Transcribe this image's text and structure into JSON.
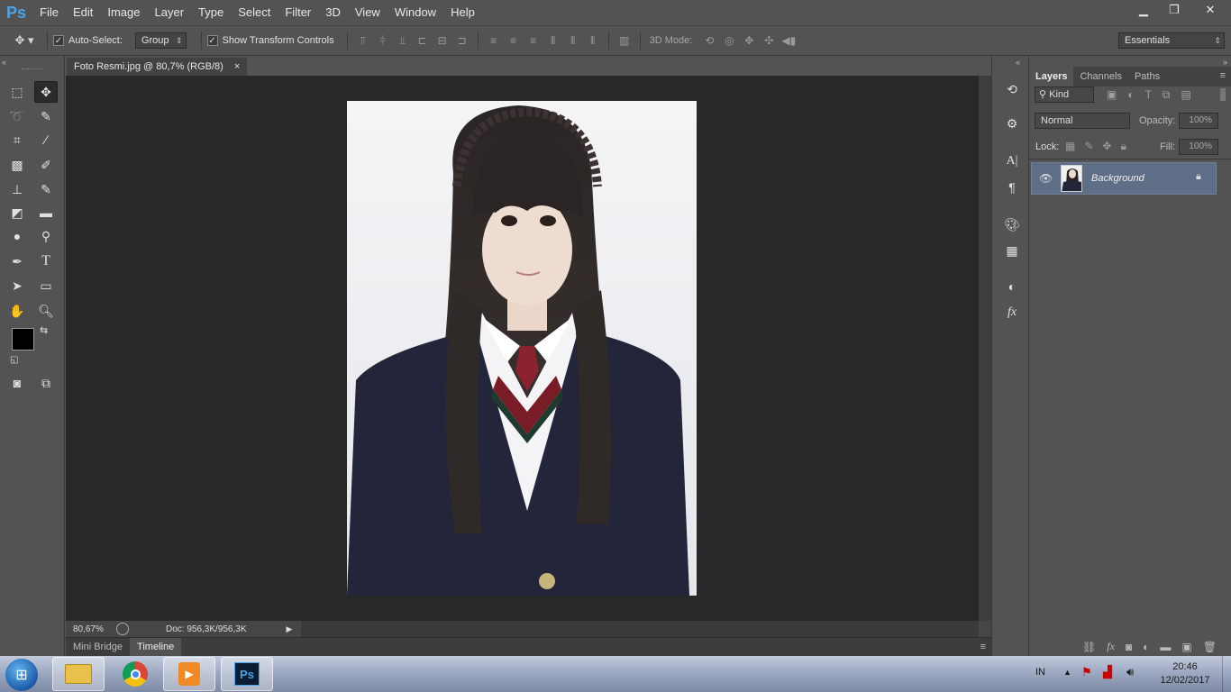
{
  "app": {
    "logo": "Ps"
  },
  "menu": [
    "File",
    "Edit",
    "Image",
    "Layer",
    "Type",
    "Select",
    "Filter",
    "3D",
    "View",
    "Window",
    "Help"
  ],
  "window_controls": {
    "minimize": "minimize-icon",
    "restore": "restore-icon",
    "close": "close-icon"
  },
  "options": {
    "auto_select_label": "Auto-Select:",
    "auto_select_checked": true,
    "auto_select_target": "Group",
    "show_transform_label": "Show Transform Controls",
    "show_transform_checked": true,
    "mode_3d_label": "3D Mode:",
    "workspace": "Essentials"
  },
  "document": {
    "tab_title": "Foto Resmi.jpg @ 80,7% (RGB/8)",
    "close_glyph": "×",
    "zoom": "80,67%",
    "doc_info": "Doc: 956,3K/956,3K"
  },
  "bottom_tabs": [
    "Mini Bridge",
    "Timeline"
  ],
  "panels": {
    "tabs": [
      "Layers",
      "Channels",
      "Paths"
    ],
    "filter_kind": "Kind",
    "blend_mode": "Normal",
    "opacity_label": "Opacity:",
    "opacity_value": "100%",
    "lock_label": "Lock:",
    "fill_label": "Fill:",
    "fill_value": "100%",
    "layers": [
      {
        "name": "Background",
        "visible": true,
        "locked": true
      }
    ]
  },
  "taskbar": {
    "lang": "IN",
    "time": "20:46",
    "date": "12/02/2017",
    "apps": [
      "file-explorer-icon",
      "chrome-icon",
      "media-player-icon",
      "photoshop-icon"
    ]
  },
  "colors": {
    "ui_bg": "#535353",
    "canvas_bg": "#282828",
    "ps_blue": "#4aa3e8",
    "selected_layer": "#5f6e87",
    "foreground_color": "#000000",
    "background_color": "#ffffff"
  }
}
